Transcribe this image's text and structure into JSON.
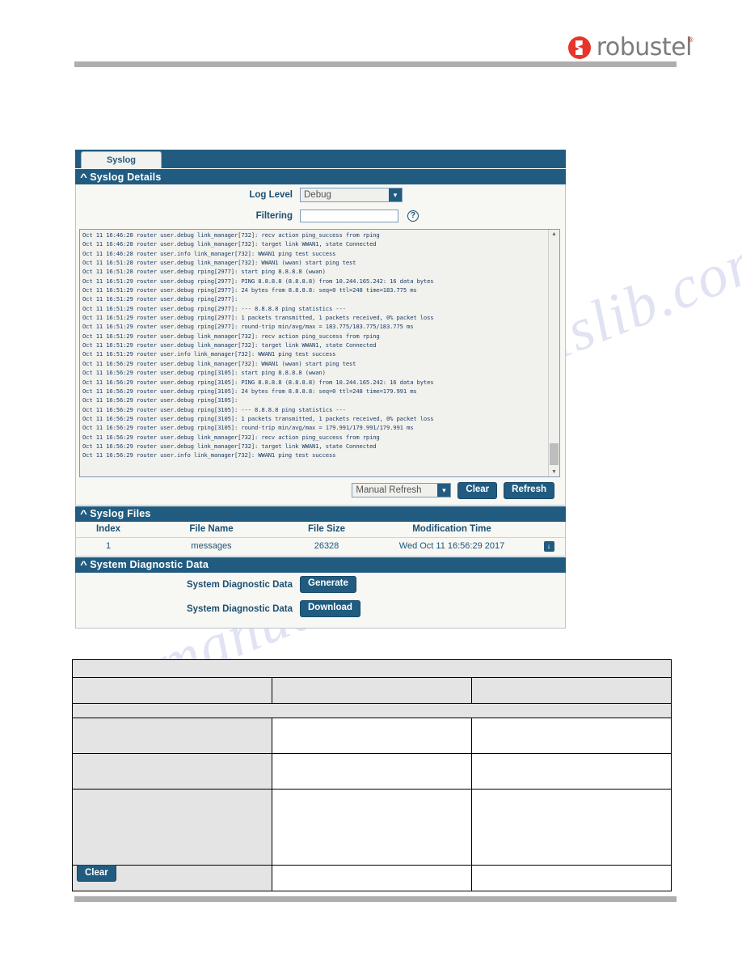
{
  "brand": {
    "name": "robustel",
    "logo_icon": "robustel-circle-logo",
    "trademark": "®"
  },
  "tabs": [
    {
      "label": "Syslog",
      "active": true
    }
  ],
  "sections": {
    "syslog_details": {
      "title": "Syslog Details",
      "collapse_icon": "chevron-up-icon",
      "fields": {
        "log_level_label": "Log Level",
        "log_level_value": "Debug",
        "filtering_label": "Filtering",
        "filtering_value": "",
        "filtering_placeholder": "",
        "help_icon": "question-mark-icon"
      },
      "console": {
        "lines": [
          "Oct 11 16:46:28 router user.debug link_manager[732]: recv action ping_success from rping",
          "Oct 11 16:46:28 router user.debug link_manager[732]: target link WWAN1, state Connected",
          "Oct 11 16:46:28 router user.info link_manager[732]: WWAN1 ping test success",
          "Oct 11 16:51:28 router user.debug link_manager[732]: WWAN1 (wwan) start ping test",
          "Oct 11 16:51:28 router user.debug rping[2977]: start ping 8.8.8.8 (wwan)",
          "Oct 11 16:51:29 router user.debug rping[2977]: PING 8.8.8.8 (8.8.8.8) from 10.244.165.242: 16 data bytes",
          "Oct 11 16:51:29 router user.debug rping[2977]: 24 bytes from 8.8.8.8: seq=0 ttl=248 time=183.775 ms",
          "Oct 11 16:51:29 router user.debug rping[2977]:",
          "Oct 11 16:51:29 router user.debug rping[2977]: --- 8.8.8.8 ping statistics ---",
          "Oct 11 16:51:29 router user.debug rping[2977]: 1 packets transmitted, 1 packets received, 0% packet loss",
          "Oct 11 16:51:29 router user.debug rping[2977]: round-trip min/avg/max = 183.775/183.775/183.775 ms",
          "Oct 11 16:51:29 router user.debug link_manager[732]: recv action ping_success from rping",
          "Oct 11 16:51:29 router user.debug link_manager[732]: target link WWAN1, state Connected",
          "Oct 11 16:51:29 router user.info link_manager[732]: WWAN1 ping test success",
          "Oct 11 16:56:29 router user.debug link_manager[732]: WWAN1 (wwan) start ping test",
          "Oct 11 16:56:29 router user.debug rping[3105]: start ping 8.8.8.8 (wwan)",
          "Oct 11 16:56:29 router user.debug rping[3105]: PING 8.8.8.8 (8.8.8.8) from 10.244.165.242: 16 data bytes",
          "Oct 11 16:56:29 router user.debug rping[3105]: 24 bytes from 8.8.8.8: seq=0 ttl=248 time=179.991 ms",
          "Oct 11 16:56:29 router user.debug rping[3105]:",
          "Oct 11 16:56:29 router user.debug rping[3105]: --- 8.8.8.8 ping statistics ---",
          "Oct 11 16:56:29 router user.debug rping[3105]: 1 packets transmitted, 1 packets received, 0% packet loss",
          "Oct 11 16:56:29 router user.debug rping[3105]: round-trip min/avg/max = 179.991/179.991/179.991 ms",
          "Oct 11 16:56:29 router user.debug link_manager[732]: recv action ping_success from rping",
          "Oct 11 16:56:29 router user.debug link_manager[732]: target link WWAN1, state Connected",
          "Oct 11 16:56:29 router user.info link_manager[732]: WWAN1 ping test success"
        ],
        "scroll_up_icon": "scroll-up-arrow-icon",
        "scroll_down_icon": "scroll-down-arrow-icon"
      },
      "controls": {
        "refresh_mode": "Manual Refresh",
        "clear_label": "Clear",
        "refresh_label": "Refresh"
      }
    },
    "syslog_files": {
      "title": "Syslog Files",
      "collapse_icon": "chevron-up-icon",
      "columns": [
        "Index",
        "File Name",
        "File Size",
        "Modification Time"
      ],
      "rows": [
        {
          "index": "1",
          "file_name": "messages",
          "file_size": "26328",
          "modification_time": "Wed Oct 11 16:56:29 2017",
          "action_icon": "download-icon"
        }
      ]
    },
    "system_diagnostic": {
      "title": "System Diagnostic Data",
      "collapse_icon": "chevron-up-icon",
      "rows": [
        {
          "label": "System Diagnostic Data",
          "button": "Generate"
        },
        {
          "label": "System Diagnostic Data",
          "button": "Download"
        }
      ]
    }
  },
  "spec_table": {
    "rows": [
      {
        "type": "header",
        "cells": [
          ""
        ]
      },
      {
        "type": "subhead",
        "cells": [
          "",
          "",
          ""
        ]
      },
      {
        "type": "group",
        "cells": [
          ""
        ]
      },
      {
        "type": "data",
        "cells": [
          "",
          "",
          ""
        ]
      },
      {
        "type": "data",
        "cells": [
          "",
          "",
          ""
        ]
      },
      {
        "type": "data",
        "cells": [
          "",
          "",
          ""
        ]
      },
      {
        "type": "button",
        "cells": [
          "Clear",
          "",
          ""
        ]
      }
    ]
  },
  "watermark": {
    "line_a": "manualslib.com",
    "line_b": "manualslib.com"
  },
  "colors": {
    "panel_header": "#215C80",
    "panel_body": "#F7F7F3",
    "log_text": "#1E3F6B",
    "brand_red": "#E8342A",
    "rule_gray": "#AEAEAE"
  }
}
